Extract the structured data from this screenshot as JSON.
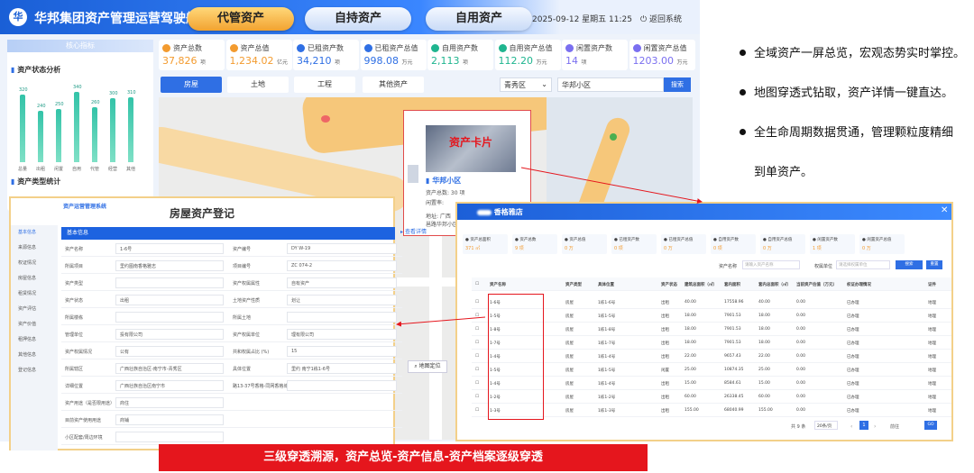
{
  "header": {
    "title": "华邦集团资产管理运营驾驶舱",
    "logo": "华",
    "tabs": [
      "代管资产",
      "自持资产",
      "自用资产"
    ],
    "datetime": "2025-09-12 星期五 11:25",
    "back": "返回系统"
  },
  "left": {
    "head": "核心指标",
    "status_title": "资产状态分析",
    "type_title": "资产类型统计",
    "bars": [
      {
        "v": "320",
        "x": "总量",
        "h": 0.92
      },
      {
        "v": "240",
        "x": "出租",
        "h": 0.7
      },
      {
        "v": "250",
        "x": "闲置",
        "h": 0.72
      },
      {
        "v": "340",
        "x": "自用",
        "h": 0.95
      },
      {
        "v": "260",
        "x": "代管",
        "h": 0.74
      },
      {
        "v": "300",
        "x": "经营",
        "h": 0.86
      },
      {
        "v": "310",
        "x": "其他",
        "h": 0.88
      }
    ]
  },
  "stats": [
    {
      "label": "资产总数",
      "value": "37,826",
      "unit": "项",
      "color": "#f39b2f"
    },
    {
      "label": "资产总值",
      "value": "1,234.02",
      "unit": "亿元",
      "color": "#f39b2f"
    },
    {
      "label": "已租资产数",
      "value": "34,210",
      "unit": "项",
      "color": "#2f6fe4"
    },
    {
      "label": "已租资产总值",
      "value": "998.08",
      "unit": "万元",
      "color": "#2f6fe4"
    },
    {
      "label": "自用资产数",
      "value": "2,113",
      "unit": "项",
      "color": "#1fb58f"
    },
    {
      "label": "自用资产总值",
      "value": "112.20",
      "unit": "万元",
      "color": "#1fb58f"
    },
    {
      "label": "闲置资产数",
      "value": "14",
      "unit": "项",
      "color": "#7a6ff0"
    },
    {
      "label": "闲置资产总值",
      "value": "1203.00",
      "unit": "万元",
      "color": "#7a6ff0"
    }
  ],
  "filters": {
    "tabs": [
      "房屋",
      "土地",
      "工程",
      "其他资产"
    ],
    "district": "青秀区",
    "search_value": "华邦小区",
    "search_btn": "搜索"
  },
  "map": {
    "card_title": "资产卡片",
    "community": "华邦小区",
    "count_label": "资产总数: 30 项",
    "idle_label": "闲置率:",
    "address_label": "地址: 广西",
    "address2": "邕路华邦小区",
    "detail": "查看详情",
    "locate": "地图定位"
  },
  "form": {
    "brand": "资产运营管理系统",
    "title": "房屋资产登记",
    "section": "基本信息",
    "sidebar": [
      "基本信息",
      "来源信息",
      "权证情况",
      "房屋信息",
      "租赁情况",
      "资产评估",
      "资产价值",
      "租押信息",
      "其他信息",
      "登记信息"
    ],
    "rows": [
      [
        "资产名称",
        "1-6号",
        "资产编号",
        "DY",
        "W-19"
      ],
      [
        "所属项目",
        "里约图南香格雅志",
        "项目编号",
        "ZC",
        "074-2"
      ],
      [
        "资产类型",
        "",
        "资产权属属性",
        "自有资产"
      ],
      [
        "资产状态",
        "出租",
        "土地资产性质",
        "划让"
      ],
      [
        "所属楼栋",
        "",
        "所属土地",
        ""
      ],
      [
        "管理单位",
        "投有限公司",
        "资产权属单位",
        "理有限公司"
      ],
      [
        "资产权属情况",
        "公有",
        "共和权属占比 (%)",
        "15"
      ],
      [
        "所属辖区",
        "广西壮族自治区-南宁市-青秀区",
        "具体位置",
        "里约",
        "南宁1栋1-6号"
      ],
      [
        "详细位置",
        "广西壮族自治区南宁市",
        "路13-37号香格-同网香格城"
      ],
      [
        "资产用途（是否限用途）",
        "商住"
      ],
      [
        "目前资产使用用途",
        "商铺"
      ],
      [
        "小区配套/周边环境",
        ""
      ]
    ]
  },
  "table": {
    "title": "香格雅店",
    "stats": [
      {
        "l": "资产总面积",
        "v": "371 ㎡"
      },
      {
        "l": "资产总数",
        "v": "9 项"
      },
      {
        "l": "资产总值",
        "v": "0 万"
      },
      {
        "l": "已租资产数",
        "v": "0 项"
      },
      {
        "l": "已租资产总值",
        "v": "0 万"
      },
      {
        "l": "自用资产数",
        "v": "0 项"
      },
      {
        "l": "自用资产总值",
        "v": "0 万"
      },
      {
        "l": "闲置资产数",
        "v": "1 项"
      },
      {
        "l": "闲置资产总值",
        "v": "0 万"
      }
    ],
    "search_label": "资产名称",
    "search_ph": "请输入资产名称",
    "dept_label": "权属单位",
    "dept_ph": "请选择权属单位",
    "btn_search": "搜索",
    "btn_reset": "重置",
    "cols": [
      "资产名称",
      "资产类型",
      "具体位置",
      "资产状态",
      "建筑总面积（㎡）",
      "套内面积",
      "套内总面积（㎡）",
      "当前资产估值（万元）",
      "权证办理情况",
      "证件"
    ],
    "rows": [
      [
        "1-6号",
        "房屋",
        "1栋1-6号",
        "出租",
        "40.00",
        "17558.96",
        "40.00",
        "0.00",
        "已办理",
        "地理"
      ],
      [
        "1-5号",
        "房屋",
        "1栋1-5号",
        "出租",
        "18.00",
        "7901.53",
        "18.00",
        "0.00",
        "已办理",
        "地理"
      ],
      [
        "1-8号",
        "房屋",
        "1栋1-8号",
        "出租",
        "18.00",
        "7901.53",
        "18.00",
        "0.00",
        "已办理",
        "地理"
      ],
      [
        "1-7号",
        "房屋",
        "1栋1-7号",
        "出租",
        "18.00",
        "7901.53",
        "18.00",
        "0.00",
        "已办理",
        "地理"
      ],
      [
        "1-4号",
        "房屋",
        "1栋1-4号",
        "出租",
        "22.00",
        "9657.43",
        "22.00",
        "0.00",
        "已办理",
        "地理"
      ],
      [
        "1-5号",
        "房屋",
        "1栋1-5号",
        "闲置",
        "25.00",
        "10874.35",
        "25.00",
        "0.00",
        "已办理",
        "地理"
      ],
      [
        "1-4号",
        "房屋",
        "1栋1-4号",
        "出租",
        "15.00",
        "8584.61",
        "15.00",
        "0.00",
        "已办理",
        "地理"
      ],
      [
        "1-2号",
        "房屋",
        "1栋1-2号",
        "出租",
        "60.00",
        "26338.45",
        "60.00",
        "0.00",
        "已办理",
        "地理"
      ],
      [
        "1-3号",
        "房屋",
        "1栋1-3号",
        "出租",
        "155.00",
        "68040.99",
        "155.00",
        "0.00",
        "已办理",
        "地理"
      ]
    ],
    "pager": {
      "total": "共 9 条",
      "size": "20条/页",
      "page": "1",
      "goto": "前往",
      "go": "GO"
    }
  },
  "bullets": [
    "全域资产一屏总览，宏观态势实时掌控。",
    "地图穿透式钻取，资产详情一键直达。",
    "全生命周期数据贯通，管理颗粒度精细",
    "到单资产。"
  ],
  "banner": "三级穿透溯源，资产总览-资产信息-资产档案逐级穿透"
}
